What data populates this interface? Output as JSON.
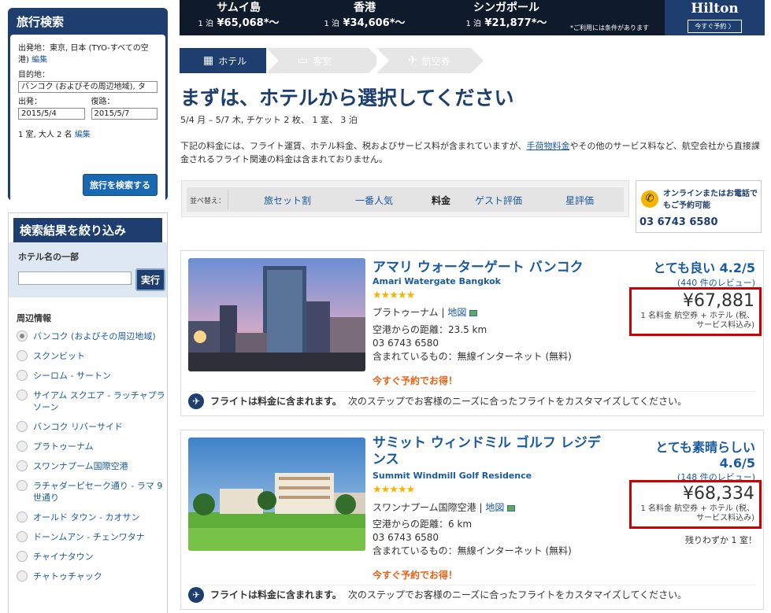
{
  "search": {
    "title": "旅行検索",
    "origin_label": "出発地：東京, 日本 (TYO-すべての空港)",
    "edit": "編集",
    "dest_label": "目的地：",
    "dest_value": "バンコク (およびその周辺地域), タ",
    "depart_label": "出発：",
    "depart_value": "2015/5/4",
    "return_label": "復路：",
    "return_value": "2015/5/7",
    "party": "1 室, 大人 2 名",
    "button": "旅行を検索する"
  },
  "filter": {
    "title": "検索結果を絞り込み",
    "name_label": "ホテル名の一部",
    "name_placeholder": "",
    "exec": "実行",
    "area_title": "周辺情報",
    "areas": [
      "バンコク (およびその周辺地域)",
      "スクンビット",
      "シーロム - サートン",
      "サイアム スクエア - ラッチャプラソーン",
      "バンコク リバーサイド",
      "プラトゥーナム",
      "スワンナプーム国際空港",
      "ラチャダーピセーク通り - ラマ 9 世通り",
      "オールド タウン - カオサン",
      "ドーンムアン - チェンワタナ",
      "チャイナタウン",
      "チャトゥチャック"
    ]
  },
  "banner": {
    "cells": [
      {
        "city": "サムイ島",
        "prefix": "1 泊",
        "price": "¥65,068",
        "suffix": "*～"
      },
      {
        "city": "香港",
        "prefix": "1 泊",
        "price": "¥34,606",
        "suffix": "*～"
      },
      {
        "city": "シンガポール",
        "prefix": "1 泊",
        "price": "¥21,877",
        "suffix": "*～"
      }
    ],
    "note": "*ご利用には条件があります",
    "brand": "Hilton",
    "reserve": "今すぐ予約 〉"
  },
  "steps": [
    "ホテル",
    "客室",
    "航空券"
  ],
  "page_title": "まずは、ホテルから選択してください",
  "subtitle": "5/4 月 – 5/7 木, チケット 2 枚、 1 室、 3 泊",
  "desc": {
    "before": "下記の料金には、フライト運賃、ホテル料金、税およびサービス料が含まれていますが、",
    "link": "手荷物料金",
    "after": "やその他のサービス料など、航空会社から直接課金されるフライト関連の料金は含まれておりません。"
  },
  "sort": {
    "label": "並べ替え：",
    "options": [
      "旅セット割",
      "一番人気",
      "料金",
      "ゲスト評価",
      "星評価"
    ],
    "selected": "料金"
  },
  "contact": {
    "text": "オンラインまたはお電話でもご予約可能",
    "phone": "03 6743 6580"
  },
  "hotels": [
    {
      "name": "アマリ ウォーターゲート バンコク",
      "name_en": "Amari Watergate Bangkok",
      "stars": "★★★★★",
      "area": "プラトゥーナム",
      "map": "地図",
      "distance": "空港からの距離：23.5 km",
      "phone": "03 6743 6580",
      "includes": "含まれているもの：無線インターネット (無料)",
      "deal": "今すぐ予約でお得！",
      "rating_label": "とても良い",
      "rating": "4.2/5",
      "reviews": "(440 件のレビュー)",
      "price": "¥67,881",
      "price_note": "1 名料金 航空券 + ホテル (税、サービス料込み)",
      "flight_bold": "フライトは料金に含まれます。",
      "flight_text": "次のステップでお客様のニーズに合ったフライトをカスタマイズしてください。",
      "remaining": ""
    },
    {
      "name": "サミット ウィンドミル ゴルフ レジデンス",
      "name_en": "Summit Windmill Golf Residence",
      "stars": "★★★★★",
      "area": "スワンナプーム国際空港",
      "map": "地図",
      "distance": "空港からの距離：6 km",
      "phone": "03 6743 6580",
      "includes": "含まれているもの：無線インターネット (無料)",
      "deal": "今すぐ予約でお得！",
      "rating_label": "とても素晴らしい",
      "rating": "4.6/5",
      "reviews": "(148 件のレビュー)",
      "price": "¥68,334",
      "price_note": "1 名料金 航空券 + ホテル (税、サービス料込み)",
      "flight_bold": "フライトは料金に含まれます。",
      "flight_text": "次のステップでお客様のニーズに合ったフライトをカスタマイズしてください。",
      "remaining": "残りわずか 1 室！"
    }
  ]
}
